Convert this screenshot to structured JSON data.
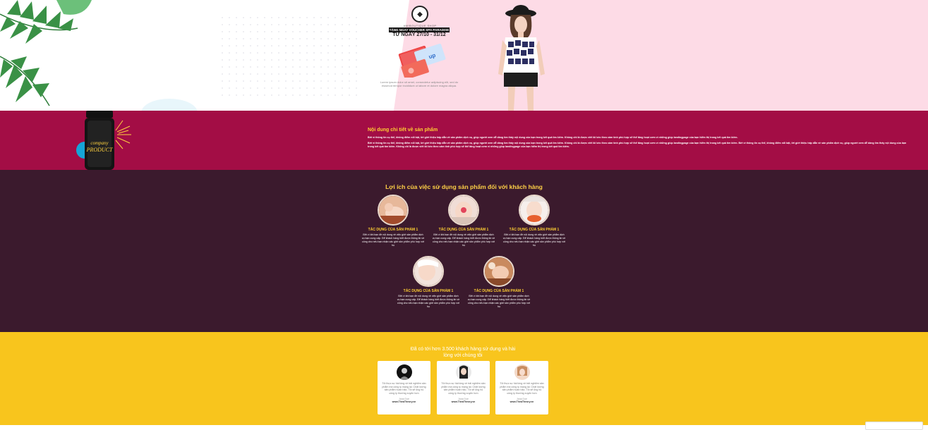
{
  "hero": {
    "brand_name": "AMIBOUTIQUE SHOP",
    "voucher_title": "TẶNG NGAY VOUCHER SPA PARADISE",
    "date_range": "TỪ NGÀY 27/10 - 31/12",
    "description": "Lorem ipsum dolor sit amet, consectetur adipiscing elit, sed do eiusmod tempor incididunt ut labore et dolore magna aliqua."
  },
  "detail": {
    "title": "Nội dung chi tiết về sản phẩm",
    "bottle_label": "company PRODUCT",
    "paragraph1": "Bởi vì thông tin cụ thể, không điểm nổi bật, lời giới thiệu hấp dẫn về sản phẩm dịch vụ, giúp người xem dễ dàng tìm thấy nội dung của bạn trong kết quả tìm kiếm. Không chỉ là được viết lôi kéo theo cảm tính phù hợp sẽ thể tăng hoạt cơm vì những giúp landingpage của bạn hiểm thị trong kết quả tìm kiếm.",
    "paragraph2": "Bởi vì thông tin cụ thể, không điểm nổi bật, lời giới thiệu hấp dẫn về sản phẩm dịch vụ, giúp người xem dễ dàng tìm thấy nội dung của bạn trong kết quả tìm kiếm. Không chỉ là được viết lôi kéo theo cảm tính phù hợp sẽ thể tăng hoạt cơm vì những giúp landingpage của bạn hiểm thị trong kết quả tìm kiếm. Bởi vì thông tin cụ thể, không điểm nổi bật, lời giới thiệu hấp dẫn về sản phẩm dịch vụ, giúp người xem dễ dàng tìm thấy nội dung của bạn trong kết quả tìm kiếm. Không chỉ là được viết lôi kéo theo cảm tính phù hợp sẽ thể tăng hoạt cơm vì những giúp landingpage của bạn hiểm thị trong kết quả tìm kiếm."
  },
  "benefits": {
    "title": "Lợi ích của việc sử dụng sản phẩm đối với khách hàng",
    "cards": [
      {
        "title": "TÁC DỤNG CỦA SẢN PHẨM 1",
        "text": "Bởi vì khi bạn đề nội dung về việc giới sản phẩm dịch vụ bạn cung cấp. Để khách hàng biết được thông tin về công cho nếu bạn nhận các giới sản phẩm phù hợp với họ"
      },
      {
        "title": "TÁC DỤNG CỦA SẢN PHẨM 1",
        "text": "Bởi vì khi bạn đề nội dung về việc giới sản phẩm dịch vụ bạn cung cấp. Để khách hàng biết được thông tin về công cho nếu bạn nhận các giới sản phẩm phù hợp với họ"
      },
      {
        "title": "TÁC DỤNG CỦA SẢN PHẨM 1",
        "text": "Bởi vì khi bạn đề nội dung về việc giới sản phẩm dịch vụ bạn cung cấp. Để khách hàng biết được thông tin về công cho nếu bạn nhận các giới sản phẩm phù hợp với họ"
      },
      {
        "title": "TÁC DỤNG CỦA SẢN PHẨM 1",
        "text": "Bởi vì khi bạn đề nội dung về việc giới sản phẩm dịch vụ bạn cung cấp. Để khách hàng biết được thông tin về công cho nếu bạn nhận các giới sản phẩm phù hợp với họ"
      },
      {
        "title": "TÁC DỤNG CỦA SẢN PHẨM 1",
        "text": "Bởi vì khi bạn đề nội dung về việc giới sản phẩm dịch vụ bạn cung cấp. Để khách hàng biết được thông tin về công cho nếu bạn nhận các giới sản phẩm phù hợp với họ"
      }
    ]
  },
  "testimonials": {
    "title": "Đã có tới hơn 3.500 khách hàng sử dụng và hài lòng với chúng tôi",
    "cards": [
      {
        "text": "Tôi thực sự hài lòng về trải nghiệm sản phẩm mà công ty mang lại. Chất lượng sản phẩm hoàn hảo. Tôi sẽ ủng hộ công ty thường xuyên hơn",
        "name": "Jana Doe",
        "role": "www.TheaTheory.vn"
      },
      {
        "text": "Tôi thực sự hài lòng về trải nghiệm sản phẩm mà công ty mang lại. Chất lượng sản phẩm hoàn hảo. Tôi sẽ ủng hộ công ty thường xuyên hơn",
        "name": "Jana Doe",
        "role": "www.TheaTheory.vn"
      },
      {
        "text": "Tôi thực sự hài lòng về trải nghiệm sản phẩm mà công ty mang lại. Chất lượng sản phẩm hoàn hảo. Tôi sẽ ủng hộ công ty thường xuyên hơn",
        "name": "Jana Doe",
        "role": "www.TheaTheory.vn"
      }
    ]
  },
  "colors": {
    "hero_pink": "#fddbe6",
    "detail_bg": "#a30d45",
    "benefits_bg": "#3b1a2d",
    "accent_yellow": "#ffcf33",
    "testimonial_bg": "#f8c51d"
  }
}
